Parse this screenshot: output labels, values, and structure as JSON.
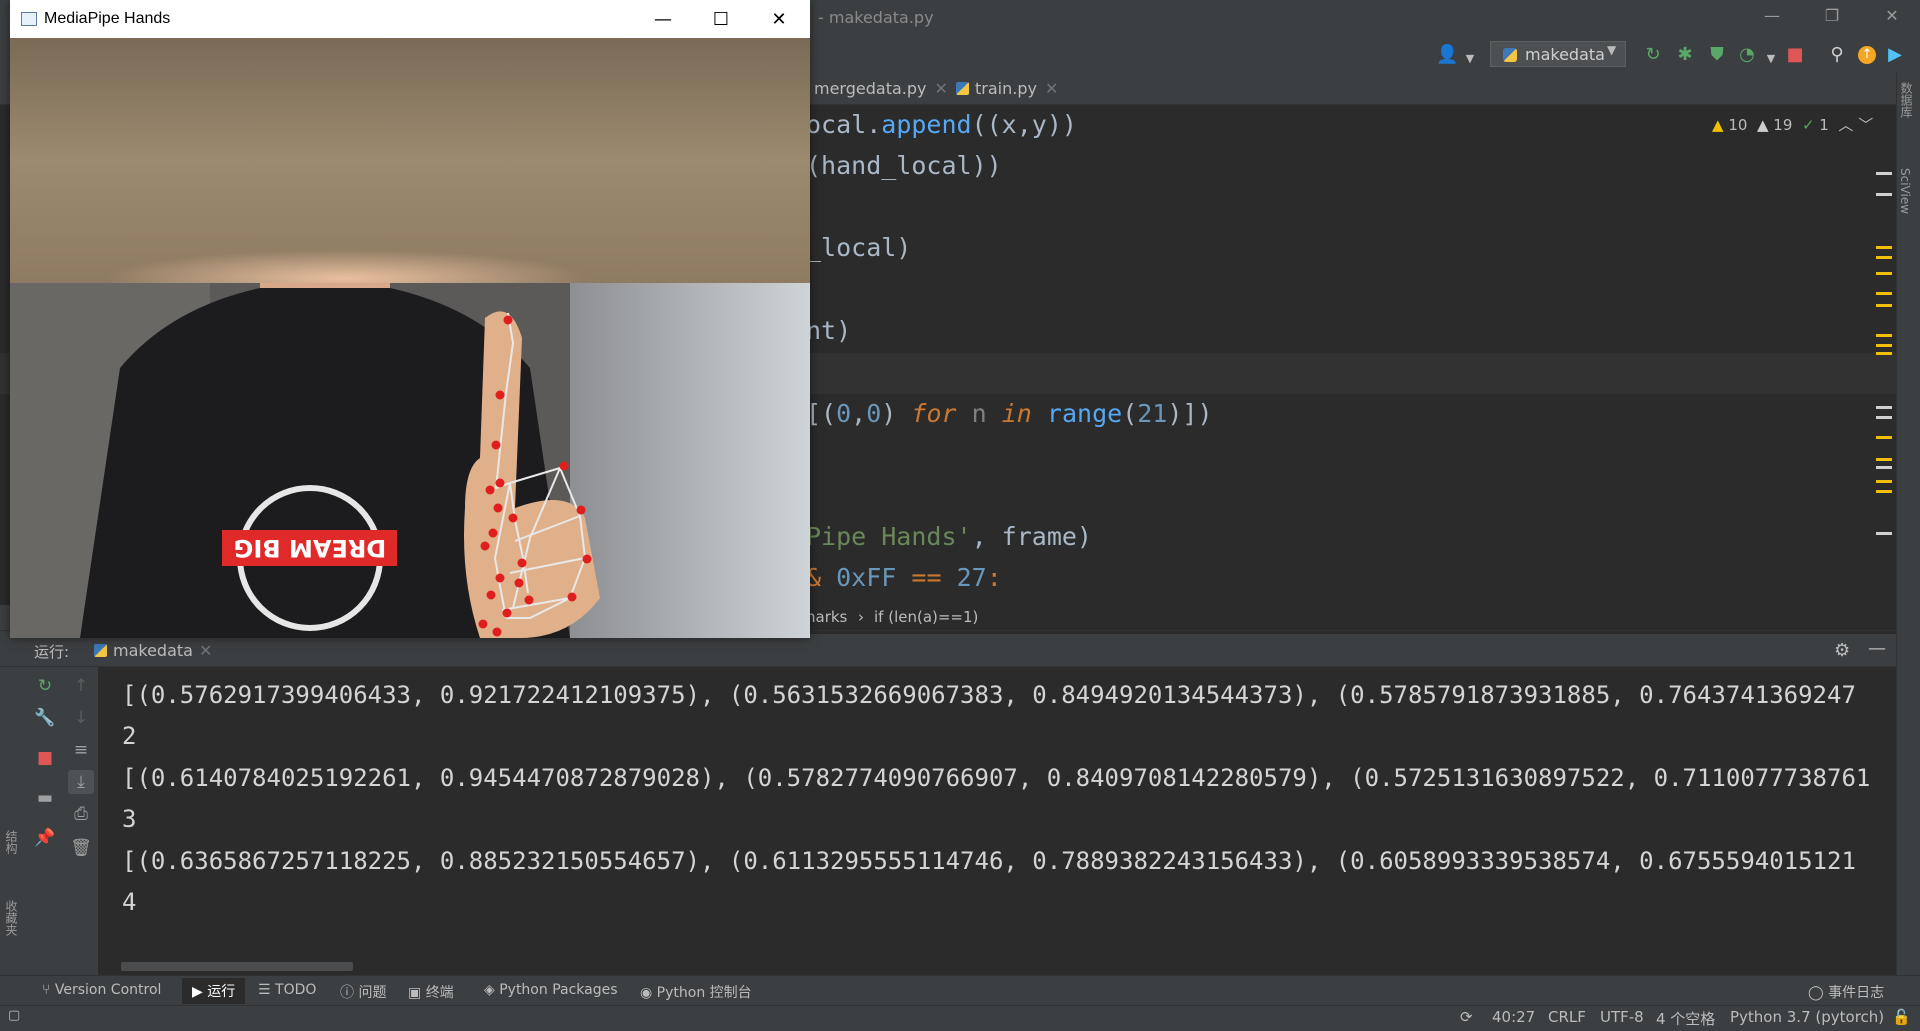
{
  "ide": {
    "title": "- makedata.py",
    "window_controls": [
      "—",
      "❐",
      "✕"
    ],
    "run_config": "makedata",
    "tabs": [
      {
        "label": "mergedata.py"
      },
      {
        "label": "train.py"
      }
    ],
    "inspections": {
      "warnings": "10",
      "weak_warnings": "19",
      "ok": "1"
    },
    "code_lines": [
      "ocal.append((x,y))",
      "(hand_local))",
      "_local)",
      "nt)",
      "[(0,0) for n in range(21)])",
      "Pipe Hands', frame)",
      "& 0xFF == 27:"
    ],
    "breadcrumb": {
      "part1": "narks",
      "sep": "›",
      "part2": "if (len(a)==1)"
    }
  },
  "run_panel": {
    "label": "运行:",
    "tab": "makedata",
    "console_lines": [
      "[(0.5762917399406433, 0.921722412109375), (0.5631532669067383, 0.8494920134544373), (0.5785791873931885, 0.7643741369247",
      "2",
      "[(0.6140784025192261, 0.9454470872879028), (0.5782774090766907, 0.8409708142280579), (0.5725131630897522, 0.7110077738761",
      "3",
      "[(0.6365867257118225, 0.885232150554657), (0.6113295555114746, 0.7889382243156433), (0.6058993339538574, 0.6755594015121",
      "4"
    ]
  },
  "right_strip": {
    "label1": "数据库",
    "label2": "SciView"
  },
  "left_strip": {
    "label1": "结构",
    "label2": "收藏夹"
  },
  "tool_tabs": [
    "Version Control",
    "运行",
    "TODO",
    "问题",
    "终端",
    "Python Packages",
    "Python 控制台"
  ],
  "event_log": "事件日志",
  "status": {
    "position": "40:27",
    "line_sep": "CRLF",
    "encoding": "UTF-8",
    "indent": "4 个空格",
    "interpreter": "Python 3.7 (pytorch)"
  },
  "mediapipe": {
    "title": "MediaPipe Hands",
    "controls": [
      "—",
      "☐",
      "✕"
    ],
    "shirt_text": "DREAM BIG"
  },
  "colors": {
    "accent_red": "#e01e1e",
    "warning": "#f0c000",
    "ide_bg": "#2b2b2b"
  }
}
